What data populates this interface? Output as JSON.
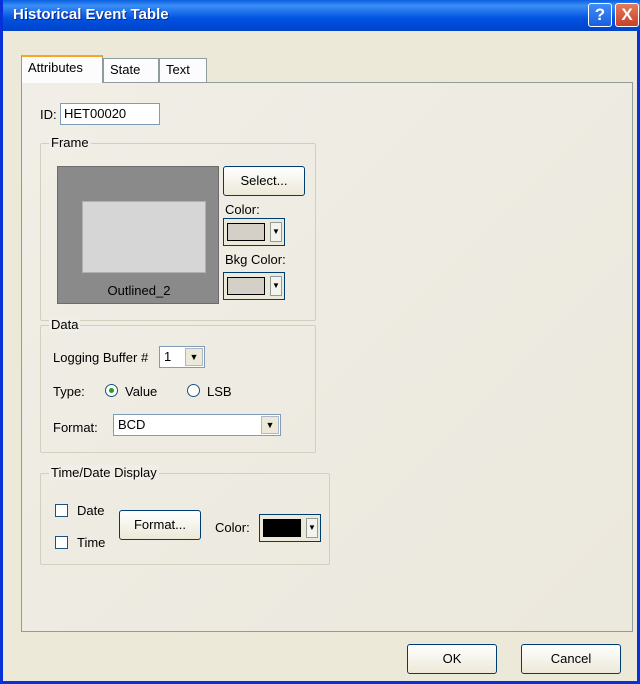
{
  "window": {
    "title": "Historical Event Table",
    "help_glyph": "?",
    "close_glyph": "X"
  },
  "tabs": [
    {
      "label": "Attributes"
    },
    {
      "label": "State"
    },
    {
      "label": "Text"
    }
  ],
  "attributes": {
    "id_label": "ID:",
    "id_value": "HET00020",
    "frame": {
      "legend": "Frame",
      "preview_name": "Outlined_2",
      "select_button": "Select...",
      "color_label": "Color:",
      "bkg_color_label": "Bkg Color:",
      "color_value": "#d4d0c8",
      "bkg_color_value": "#d4d0c8"
    },
    "data": {
      "legend": "Data",
      "logging_buffer_label": "Logging Buffer #",
      "logging_buffer_value": "1",
      "type_label": "Type:",
      "type_options": [
        "Value",
        "LSB"
      ],
      "type_selected": "Value",
      "format_label": "Format:",
      "format_value": "BCD"
    },
    "time_date": {
      "legend": "Time/Date Display",
      "date_label": "Date",
      "time_label": "Time",
      "date_checked": false,
      "time_checked": false,
      "format_button": "Format...",
      "color_label": "Color:",
      "color_value": "#000000"
    }
  },
  "buttons": {
    "ok": "OK",
    "cancel": "Cancel"
  },
  "icons": {
    "dropdown": "chevron-down-icon",
    "help": "help-icon",
    "close": "close-icon"
  }
}
